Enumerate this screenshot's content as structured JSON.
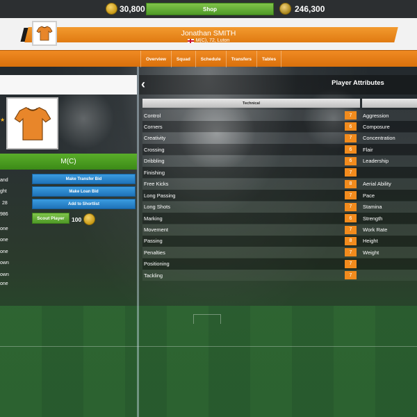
{
  "topbar": {
    "coins": "30,800",
    "shop_label": "Shop",
    "cash": "246,300"
  },
  "header": {
    "player_name": "Jonathan SMITH",
    "player_sub": "M(C), 72, Luton",
    "flag": "england-flag-icon",
    "shirt_color": "#e8862a"
  },
  "nav": {
    "tabs": [
      "Overview",
      "Squad",
      "Schedule",
      "Transfers",
      "Tables"
    ]
  },
  "left": {
    "position": "M(C)",
    "info_labels": [
      "and",
      "ght",
      "28",
      "986",
      "one",
      "one",
      "one",
      "own",
      "own",
      "one"
    ],
    "buttons": {
      "transfer": "Make Transfer Bid",
      "loan": "Make Loan Bid",
      "shortlist": "Add to Shortlist",
      "scout": "Scout Player",
      "scout_cost": "100"
    }
  },
  "attributes": {
    "title": "Player Attributes",
    "technical_header": "Technical",
    "technical": [
      {
        "name": "Control",
        "value": "7"
      },
      {
        "name": "Corners",
        "value": "6"
      },
      {
        "name": "Creativity",
        "value": "7"
      },
      {
        "name": "Crossing",
        "value": "6"
      },
      {
        "name": "Dribbling",
        "value": "6"
      },
      {
        "name": "Finishing",
        "value": "7"
      },
      {
        "name": "Free Kicks",
        "value": "8"
      },
      {
        "name": "Long Passing",
        "value": "7"
      },
      {
        "name": "Long Shots",
        "value": "7"
      },
      {
        "name": "Marking",
        "value": "6"
      },
      {
        "name": "Movement",
        "value": "7"
      },
      {
        "name": "Passing",
        "value": "8"
      },
      {
        "name": "Penalties",
        "value": "7"
      },
      {
        "name": "Positioning",
        "value": "7"
      },
      {
        "name": "Tackling",
        "value": "7"
      }
    ],
    "right_column": [
      "Aggression",
      "Composure",
      "Concentration",
      "Flair",
      "Leadership",
      "",
      "Aerial Ability",
      "Pace",
      "Stamina",
      "Strength",
      "Work Rate",
      "Height",
      "Weight",
      "",
      ""
    ]
  },
  "colors": {
    "accent_orange": "#f28b1d",
    "button_blue": "#2a86cc",
    "button_green": "#5aae2a"
  }
}
